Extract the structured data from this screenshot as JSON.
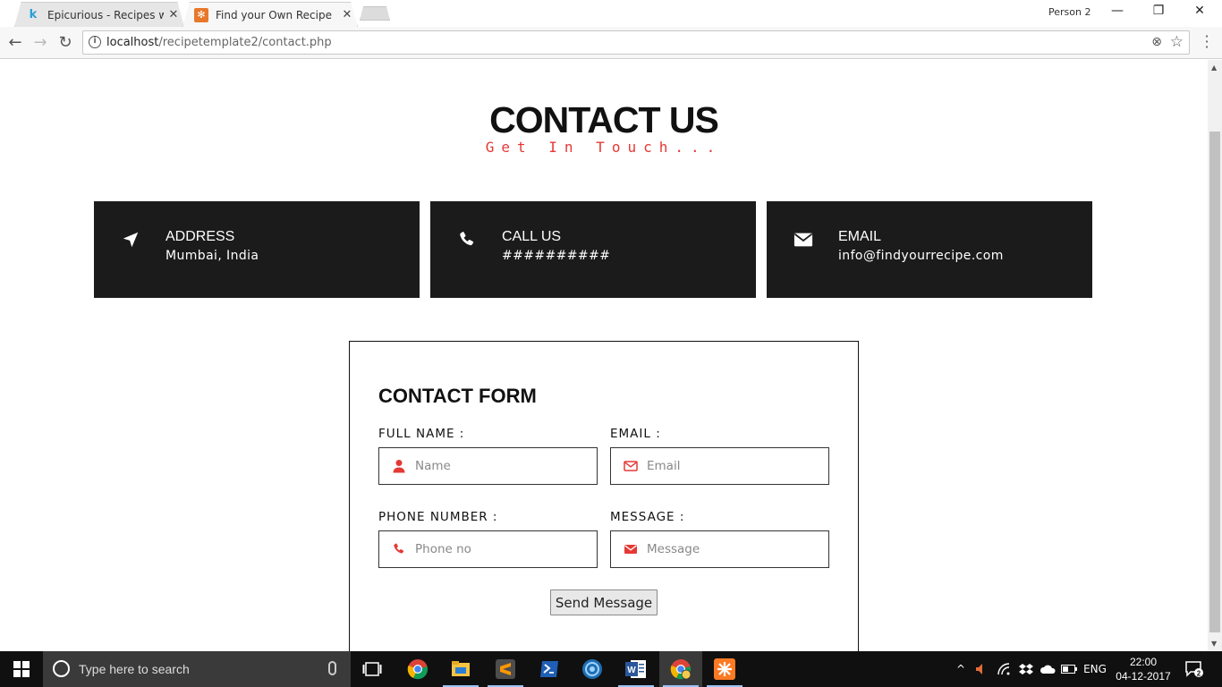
{
  "browser": {
    "tabs": [
      {
        "title": "Epicurious - Recipes with",
        "favicon": "k-logo-icon",
        "active": false
      },
      {
        "title": "Find your Own Recipe",
        "favicon": "xampp-icon",
        "active": true
      }
    ],
    "profile": "Person 2",
    "url_host": "localhost",
    "url_path": "/recipetemplate2/contact.php"
  },
  "page": {
    "title": "CONTACT US",
    "subtitle": "Get In Touch...",
    "cards": [
      {
        "label": "ADDRESS",
        "value": "Mumbai, India",
        "icon": "location-arrow-icon"
      },
      {
        "label": "CALL US",
        "value": "##########",
        "icon": "phone-icon"
      },
      {
        "label": "EMAIL",
        "value": "info@findyourrecipe.com",
        "icon": "envelope-icon"
      }
    ],
    "form": {
      "title": "CONTACT FORM",
      "fields": {
        "name": {
          "label": "FULL NAME :",
          "placeholder": "Name",
          "icon": "user-icon"
        },
        "email": {
          "label": "EMAIL :",
          "placeholder": "Email",
          "icon": "envelope-outline-icon"
        },
        "phone": {
          "label": "PHONE NUMBER :",
          "placeholder": "Phone no",
          "icon": "phone-icon"
        },
        "message": {
          "label": "MESSAGE :",
          "placeholder": "Message",
          "icon": "envelope-icon"
        }
      },
      "submit_label": "Send Message"
    },
    "accent_color": "#e53935",
    "card_color": "#1b1b1b"
  },
  "taskbar": {
    "search_placeholder": "Type here to search",
    "language": "ENG",
    "time": "22:00",
    "date": "04-12-2017",
    "notification_count": "2"
  }
}
